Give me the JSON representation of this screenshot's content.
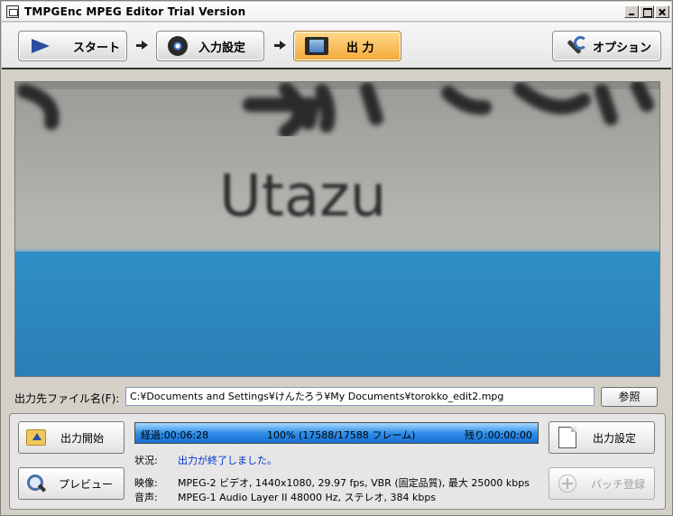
{
  "window": {
    "title": "TMPGEnc MPEG Editor Trial Version"
  },
  "nav": {
    "start_label": "スタート",
    "input_label": "入力設定",
    "output_label": "出 力",
    "option_label": "オプション",
    "active": "output"
  },
  "preview": {
    "caption_text": "Utazu"
  },
  "output_file": {
    "label": "出力先ファイル名(F):",
    "value": "C:¥Documents and Settings¥けんたろう¥My Documents¥torokko_edit2.mpg",
    "browse_label": "参照"
  },
  "actions": {
    "encode_label": "出力開始",
    "preview_label": "プレビュー",
    "output_settings_label": "出力設定",
    "batch_label": "バッチ登録"
  },
  "progress": {
    "elapsed": "経過:00:06:28",
    "percent_text": "100% (17588/17588 フレーム)",
    "remaining": "残り:00:00:00",
    "fraction": 1.0
  },
  "info": {
    "status_label": "状況:",
    "status_value": "出力が終了しました。",
    "video_label": "映像:",
    "video_value": "MPEG-2 ビデオ, 1440x1080, 29.97 fps, VBR (固定品質), 最大 25000 kbps",
    "audio_label": "音声:",
    "audio_value": "MPEG-1 Audio Layer II 48000 Hz, ステレオ, 384 kbps"
  },
  "colors": {
    "active_tab": "#f2a93a",
    "progress": "#2f8fe8",
    "status_text": "#0033cc"
  }
}
